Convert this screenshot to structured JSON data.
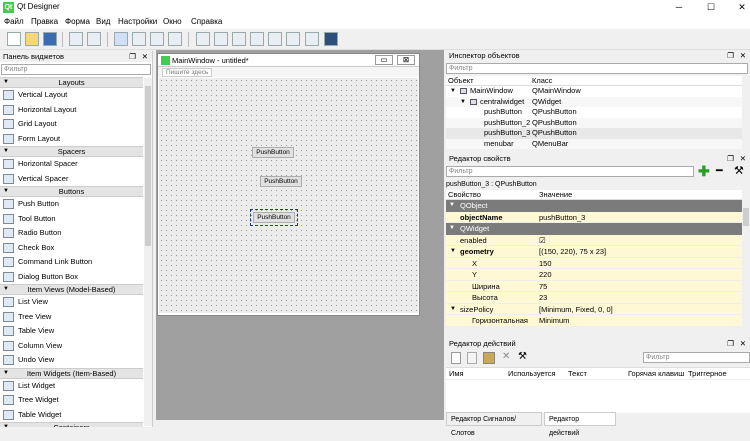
{
  "app": {
    "title": "Qt Designer",
    "logo": "Qt"
  },
  "menu": [
    "Файл",
    "Правка",
    "Форма",
    "Вид",
    "Настройки",
    "Окно",
    "Справка"
  ],
  "widget_box": {
    "title": "Панель виджетов",
    "filter_placeholder": "Фильтр",
    "sections": [
      {
        "name": "Layouts",
        "items": [
          "Vertical Layout",
          "Horizontal Layout",
          "Grid Layout",
          "Form Layout"
        ]
      },
      {
        "name": "Spacers",
        "items": [
          "Horizontal Spacer",
          "Vertical Spacer"
        ]
      },
      {
        "name": "Buttons",
        "items": [
          "Push Button",
          "Tool Button",
          "Radio Button",
          "Check Box",
          "Command Link Button",
          "Dialog Button Box"
        ]
      },
      {
        "name": "Item Views (Model-Based)",
        "items": [
          "List View",
          "Tree View",
          "Table View",
          "Column View",
          "Undo View"
        ]
      },
      {
        "name": "Item Widgets (Item-Based)",
        "items": [
          "List Widget",
          "Tree Widget",
          "Table Widget"
        ]
      },
      {
        "name": "Containers",
        "items": []
      }
    ]
  },
  "form": {
    "title": "MainWindow - untitled*",
    "menu_placeholder": "Пишите здесь",
    "buttons": [
      "PushButton",
      "PushButton",
      "PushButton"
    ]
  },
  "object_inspector": {
    "title": "Инспектор объектов",
    "filter_placeholder": "Фильтр",
    "col_object": "Объект",
    "col_class": "Класс",
    "rows": [
      [
        "MainWindow",
        "QMainWindow"
      ],
      [
        "centralwidget",
        "QWidget"
      ],
      [
        "pushButton",
        "QPushButton"
      ],
      [
        "pushButton_2",
        "QPushButton"
      ],
      [
        "pushButton_3",
        "QPushButton"
      ],
      [
        "menubar",
        "QMenuBar"
      ]
    ]
  },
  "property_editor": {
    "title": "Редактор свойств",
    "filter_placeholder": "Фильтр",
    "subtitle": "pushButton_3 : QPushButton",
    "col_prop": "Свойство",
    "col_val": "Значение",
    "rows": [
      {
        "type": "group",
        "k": "QObject"
      },
      {
        "type": "row",
        "k": "objectName",
        "v": "pushButton_3",
        "bold": true,
        "yellow": true
      },
      {
        "type": "group",
        "k": "QWidget"
      },
      {
        "type": "row",
        "k": "enabled",
        "v": "☑",
        "bold": false,
        "yellow": true
      },
      {
        "type": "row",
        "k": "geometry",
        "v": "[(150, 220), 75 x 23]",
        "bold": true,
        "yellow": true
      },
      {
        "type": "sub",
        "k": "X",
        "v": "150"
      },
      {
        "type": "sub",
        "k": "Y",
        "v": "220"
      },
      {
        "type": "sub",
        "k": "Ширина",
        "v": "75"
      },
      {
        "type": "sub",
        "k": "Высота",
        "v": "23"
      },
      {
        "type": "row",
        "k": "sizePolicy",
        "v": "[Minimum, Fixed, 0, 0]",
        "bold": false,
        "yellow": true
      },
      {
        "type": "sub",
        "k": "Горизонтальная",
        "v": "Minimum"
      }
    ]
  },
  "action_editor": {
    "title": "Редактор действий",
    "filter_placeholder": "Фильтр",
    "cols": [
      "Имя",
      "Используется",
      "Текст",
      "Горячая клавиш",
      "Триггерное"
    ]
  },
  "bottom_tabs": [
    "Редактор Сигналов/Слотов",
    "Редактор действий"
  ]
}
